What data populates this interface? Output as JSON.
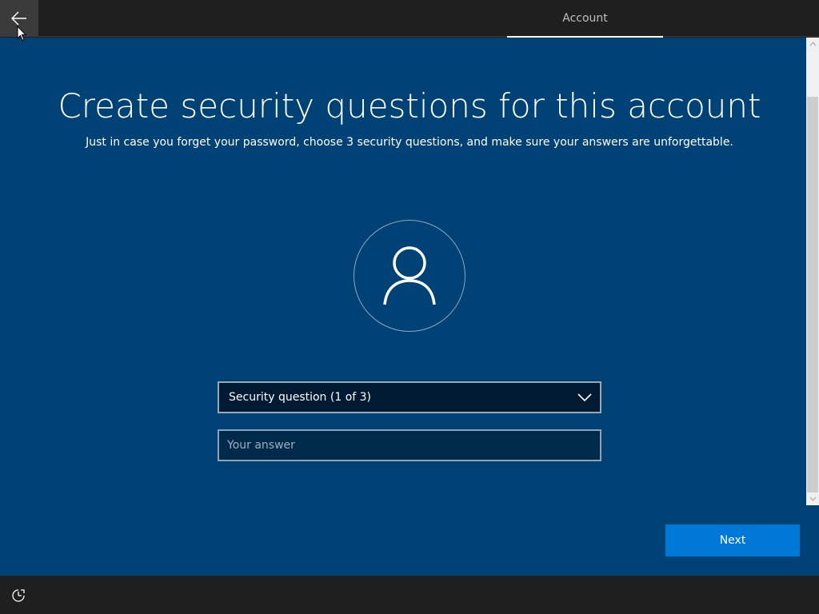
{
  "header": {
    "back_icon": "back-arrow-icon",
    "tab_label": "Account"
  },
  "main": {
    "title": "Create security questions for this account",
    "subtitle": "Just in case you forget your password, choose 3 security questions, and make sure your answers are unforgettable.",
    "avatar_icon": "user-icon",
    "question_dropdown": {
      "selected": "Security question (1 of 3)"
    },
    "answer_field": {
      "value": "",
      "placeholder": "Your answer"
    },
    "next_label": "Next"
  },
  "footer": {
    "accessibility_icon": "ease-of-access-icon"
  },
  "colors": {
    "background": "#004275",
    "topbar": "#1f1f1f",
    "accent": "#0078d7"
  }
}
